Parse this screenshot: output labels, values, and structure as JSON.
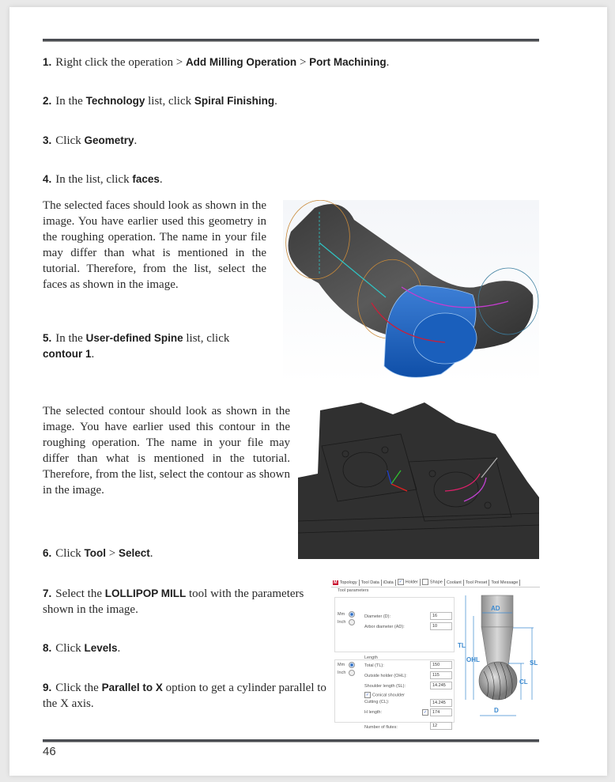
{
  "page_number": "46",
  "steps": [
    {
      "num": "1.",
      "parts": [
        "Right click the operation > ",
        "Add Milling Operation",
        " > ",
        "Port Machining",
        "."
      ]
    },
    {
      "num": "2.",
      "parts": [
        "In the ",
        "Technology",
        " list, click ",
        "Spiral Finishing",
        "."
      ]
    },
    {
      "num": "3.",
      "parts": [
        "Click ",
        "Geometry",
        "."
      ]
    },
    {
      "num": "4.",
      "parts": [
        "In the list, click ",
        "faces",
        "."
      ]
    },
    {
      "num": "5.",
      "parts": [
        "In the ",
        "User-defined Spine",
        " list, click ",
        "contour 1",
        "."
      ]
    },
    {
      "num": "6.",
      "parts": [
        "Click ",
        "Tool",
        " > ",
        "Select",
        "."
      ]
    },
    {
      "num": "7.",
      "parts": [
        "Select the ",
        "LOLLIPOP MILL",
        " tool with the parameters shown in the image."
      ]
    },
    {
      "num": "8.",
      "parts": [
        "Click ",
        "Levels",
        "."
      ]
    },
    {
      "num": "9.",
      "parts": [
        "Click the ",
        "Parallel to X",
        " option to get a cylinder parallel to the X axis."
      ]
    }
  ],
  "paragraphs": {
    "faces_note": "The selected faces should look as shown in the image. You have earlier used this geometry in the roughing operation. The name in your file may differ than what is mentioned in the tutorial. Therefore, from the list, select the faces as shown in the image.",
    "contour_note": "The selected contour should look as shown in the image. You have earlier used this contour in the roughing operation. The name in your file may differ than what is mentioned in the tutorial. Therefore, from the list, select the contour as shown in the image."
  },
  "figures": {
    "faces_image": "Selected faces on port pipe geometry",
    "contour_image": "Selected contour on cylinder head"
  },
  "tool_dialog": {
    "tabs": [
      "Topology",
      "Tool Data",
      "iData",
      "Holder",
      "Shape",
      "Coolant",
      "Tool Preset",
      "Tool Message"
    ],
    "holder_checked": true,
    "shape_checked": false,
    "group_tool_parameters": "Tool parameters",
    "group_length": "Length",
    "unit_mm": "Mm",
    "unit_inch": "Inch",
    "fields": {
      "diameter_label": "Diameter (D):",
      "diameter": "16",
      "arbor_label": "Arbor diameter (AD):",
      "arbor": "10",
      "total_label": "Total (TL):",
      "total": "150",
      "outside_label": "Outside holder (OHL):",
      "outside": "115",
      "shoulder_label": "Shoulder length (SL):",
      "shoulder": "14.245",
      "conical_label": "Conical shoulder",
      "cutting_label": "Cutting (CL):",
      "cutting": "14.245",
      "hlength_label": "H length:",
      "hlength": "174",
      "flutes_label": "Number of flutes:",
      "flutes": "12"
    },
    "diagram_labels": {
      "ad": "AD",
      "tl": "TL",
      "ohl": "OHL",
      "sl": "SL",
      "cl": "CL",
      "d": "D"
    }
  }
}
